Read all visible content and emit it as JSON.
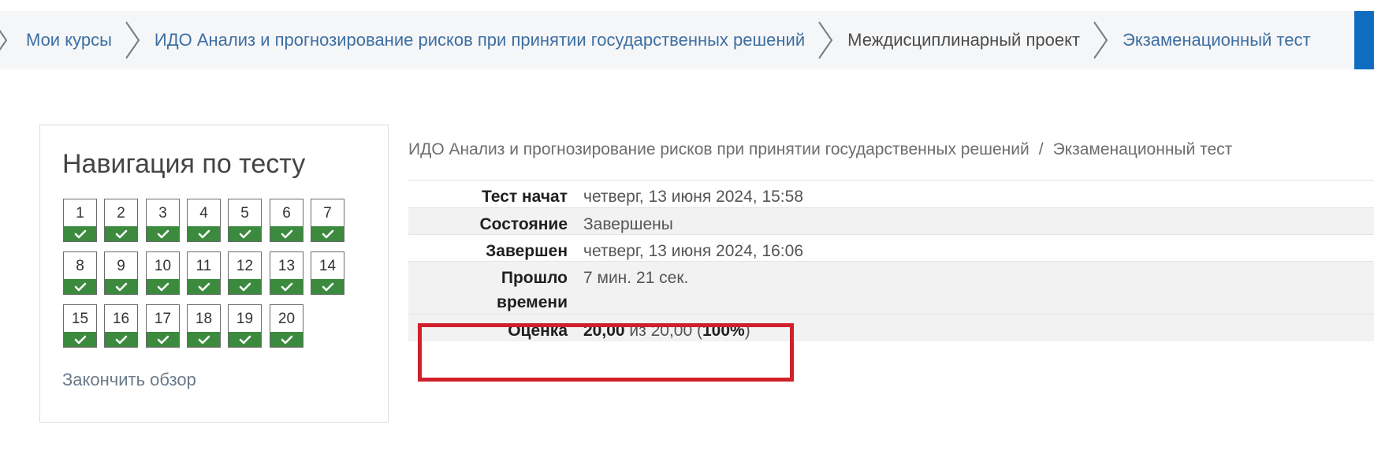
{
  "breadcrumb": {
    "items": [
      {
        "label": "Мои курсы",
        "current": false
      },
      {
        "label": "ИДО Анализ и прогнозирование рисков при принятии государственных решений",
        "current": false
      },
      {
        "label": "Междисциплинарный проект",
        "current": true
      },
      {
        "label": "Экзаменационный тест",
        "current": false
      }
    ]
  },
  "nav": {
    "title": "Навигация по тесту",
    "questions": [
      "1",
      "2",
      "3",
      "4",
      "5",
      "6",
      "7",
      "8",
      "9",
      "10",
      "11",
      "12",
      "13",
      "14",
      "15",
      "16",
      "17",
      "18",
      "19",
      "20"
    ],
    "status_icon": "check-icon",
    "finish_label": "Закончить обзор"
  },
  "content": {
    "course": "ИДО Анализ и прогнозирование рисков при принятии государственных решений",
    "separator": "/",
    "quiz": "Экзаменационный тест"
  },
  "summary": {
    "started_label": "Тест начат",
    "started_value": "четверг, 13 июня 2024, 15:58",
    "state_label": "Состояние",
    "state_value": "Завершены",
    "completed_label": "Завершен",
    "completed_value": "четверг, 13 июня 2024, 16:06",
    "time_label_1": "Прошло",
    "time_label_2": "времени",
    "time_value": "7 мин. 21 сек.",
    "grade_label": "Оценка",
    "grade_score": "20,00",
    "grade_of": "из 20,00",
    "grade_percent": "100%"
  },
  "colors": {
    "link": "#3d6fa3",
    "check_green": "#3b8a3e",
    "highlight_red": "#d0202a",
    "accent_blue": "#0f6cbf"
  }
}
